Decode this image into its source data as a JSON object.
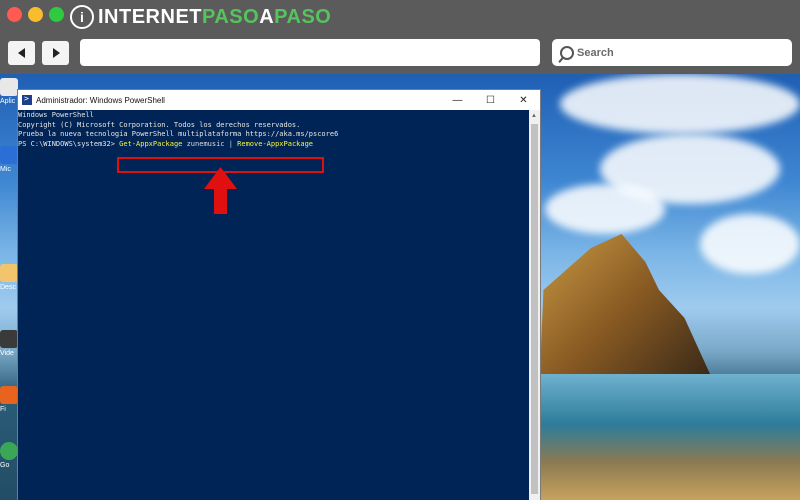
{
  "browser": {
    "logo_prefix": "INTERNET",
    "logo_accent": "PASO",
    "logo_middle": "A",
    "logo_suffix": "PASO",
    "logo_mark": "i",
    "search_placeholder": "Search",
    "back_icon": "back-arrow-icon",
    "forward_icon": "forward-arrow-icon"
  },
  "window": {
    "title": "Administrador: Windows PowerShell",
    "minimize": "—",
    "maximize": "☐",
    "close": "✕"
  },
  "console": {
    "lines": [
      "Windows PowerShell",
      "Copyright (C) Microsoft Corporation. Todos los derechos reservados.",
      "",
      "Prueba la nueva tecnología PowerShell multiplataforma https://aka.ms/pscore6",
      ""
    ],
    "prompt": "PS C:\\WINDOWS\\system32> ",
    "cmd_part1": "Get-AppxPackage",
    "cmd_part2": " zunemusic ",
    "cmd_pipe": "|",
    "cmd_part3": " Remove-AppxPackage"
  },
  "desktop_icons": [
    "Aplic",
    "Mic",
    "Desc",
    "Vide",
    "Fi",
    "Go"
  ],
  "colors": {
    "console_bg": "#012456",
    "highlight": "#e01010",
    "arrow": "#e01010",
    "cmd_yellow": "#f5f543"
  }
}
